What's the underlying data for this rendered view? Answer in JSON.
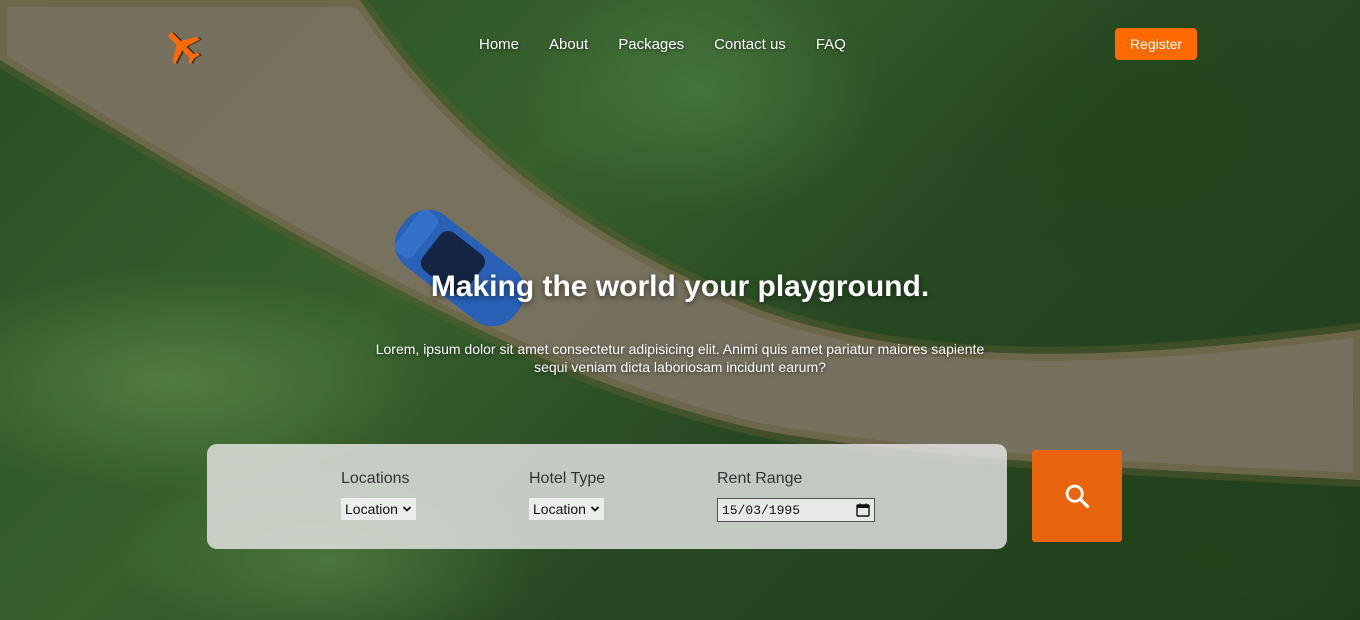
{
  "colors": {
    "accent": "#ff6a00",
    "search_button": "#e8650e"
  },
  "logo": {
    "icon": "airplane-icon"
  },
  "nav": [
    {
      "label": "Home"
    },
    {
      "label": "About"
    },
    {
      "label": "Packages"
    },
    {
      "label": "Contact us"
    },
    {
      "label": "FAQ"
    }
  ],
  "register_label": "Register",
  "hero": {
    "title": "Making the world your playground.",
    "subtitle": "Lorem, ipsum dolor sit amet consectetur adipisicing elit. Animi quis amet pariatur maiores sapiente sequi veniam dicta laboriosam incidunt earum?"
  },
  "search": {
    "locations": {
      "label": "Locations",
      "selected": "Location"
    },
    "hotel_type": {
      "label": "Hotel Type",
      "selected": "Location"
    },
    "rent_range": {
      "label": "Rent Range",
      "value": "15/03/1995"
    },
    "button_icon": "search-icon"
  }
}
